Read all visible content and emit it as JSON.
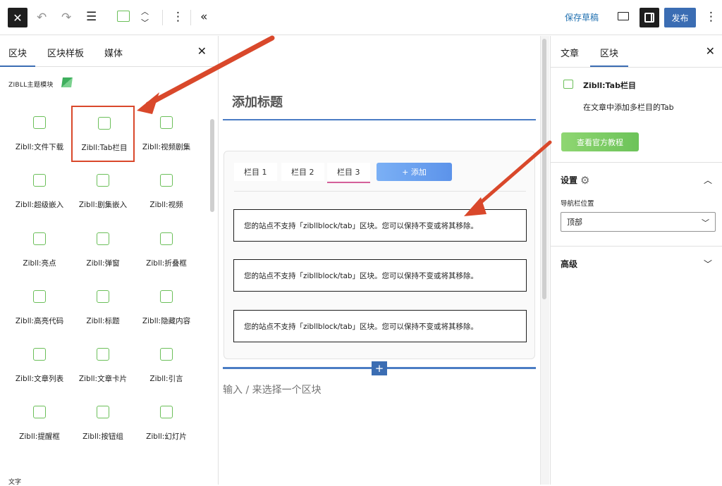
{
  "toolbar": {
    "close_icon": "close-icon",
    "save_draft": "保存草稿",
    "publish": "发布"
  },
  "left_panel": {
    "tabs": [
      "区块",
      "区块样板",
      "媒体"
    ],
    "category_title": "ZIBLL主题模块",
    "blocks": [
      {
        "label": "Zibll:文件下载",
        "icon": "folder-download-icon"
      },
      {
        "label": "Zibll:Tab栏目",
        "icon": "tab-icon",
        "highlighted": true
      },
      {
        "label": "Zibll:视频剧集",
        "icon": "video-series-icon"
      },
      {
        "label": "Zibll:超级嵌入",
        "icon": "embed-icon"
      },
      {
        "label": "Zibll:剧集嵌入",
        "icon": "series-embed-icon"
      },
      {
        "label": "Zibll:视频",
        "icon": "video-icon"
      },
      {
        "label": "Zibll:亮点",
        "icon": "award-icon"
      },
      {
        "label": "Zibll:弹窗",
        "icon": "popup-icon"
      },
      {
        "label": "Zibll:折叠框",
        "icon": "collapse-icon"
      },
      {
        "label": "Zibll:高亮代码",
        "icon": "code-icon"
      },
      {
        "label": "Zibll:标题",
        "icon": "bookmark-icon"
      },
      {
        "label": "Zibll:隐藏内容",
        "icon": "eye-off-icon"
      },
      {
        "label": "Zibll:文章列表",
        "icon": "list-icon"
      },
      {
        "label": "Zibll:文章卡片",
        "icon": "book-icon"
      },
      {
        "label": "Zibll:引言",
        "icon": "quote-icon"
      },
      {
        "label": "Zibll:提醒框",
        "icon": "info-icon"
      },
      {
        "label": "Zibll:按钮组",
        "icon": "cursor-icon"
      },
      {
        "label": "Zibll:幻灯片",
        "icon": "gallery-icon"
      }
    ],
    "next_category": "文字"
  },
  "canvas": {
    "post_title": "添加标题",
    "tabs": [
      "栏目 1",
      "栏目 2",
      "栏目 3"
    ],
    "active_tab": "栏目 3",
    "add_tab": "+ 添加",
    "notices": [
      "您的站点不支持「zibllblock/tab」区块。您可以保持不变或将其移除。",
      "您的站点不支持「zibllblock/tab」区块。您可以保持不变或将其移除。",
      "您的站点不支持「zibllblock/tab」区块。您可以保持不变或将其移除。"
    ],
    "placeholder": "输入 / 来选择一个区块",
    "insert_plus": "+"
  },
  "right_panel": {
    "tabs": [
      "文章",
      "区块"
    ],
    "block_name": "Zibll:Tab栏目",
    "block_desc": "在文章中添加多栏目的Tab",
    "doc_button": "查看官方教程",
    "settings_title": "设置",
    "nav_label": "导航栏位置",
    "nav_value": "顶部",
    "advanced_title": "高级"
  },
  "colors": {
    "accent": "#3b6db3",
    "zibll_green": "#6bbf59",
    "arrow_red": "#d9482b"
  }
}
